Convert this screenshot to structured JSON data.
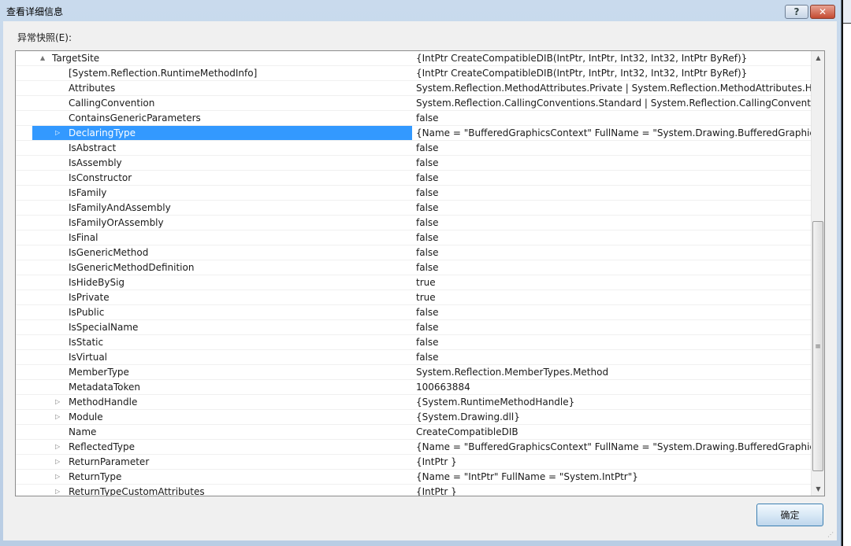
{
  "window": {
    "title": "查看详细信息",
    "help_label": "?",
    "close_label": "✕"
  },
  "snapshot_label": "异常快照(E):",
  "ok_label": "确定",
  "rows": [
    {
      "name": "TargetSite",
      "value": "{IntPtr CreateCompatibleDIB(IntPtr, IntPtr, Int32, Int32, IntPtr ByRef)}",
      "level": 0,
      "expander": "▲"
    },
    {
      "name": "[System.Reflection.RuntimeMethodInfo]",
      "value": "{IntPtr CreateCompatibleDIB(IntPtr, IntPtr, Int32, Int32, IntPtr ByRef)}",
      "level": 1,
      "expander": ""
    },
    {
      "name": "Attributes",
      "value": "System.Reflection.MethodAttributes.Private | System.Reflection.MethodAttributes.HideB",
      "level": 1,
      "expander": ""
    },
    {
      "name": "CallingConvention",
      "value": "System.Reflection.CallingConventions.Standard | System.Reflection.CallingConventions.H",
      "level": 1,
      "expander": ""
    },
    {
      "name": "ContainsGenericParameters",
      "value": "false",
      "level": 1,
      "expander": ""
    },
    {
      "name": "DeclaringType",
      "value": "{Name = \"BufferedGraphicsContext\" FullName = \"System.Drawing.BufferedGraphicsCo",
      "level": 1,
      "expander": "▷",
      "selected": true
    },
    {
      "name": "IsAbstract",
      "value": "false",
      "level": 1,
      "expander": ""
    },
    {
      "name": "IsAssembly",
      "value": "false",
      "level": 1,
      "expander": ""
    },
    {
      "name": "IsConstructor",
      "value": "false",
      "level": 1,
      "expander": ""
    },
    {
      "name": "IsFamily",
      "value": "false",
      "level": 1,
      "expander": ""
    },
    {
      "name": "IsFamilyAndAssembly",
      "value": "false",
      "level": 1,
      "expander": ""
    },
    {
      "name": "IsFamilyOrAssembly",
      "value": "false",
      "level": 1,
      "expander": ""
    },
    {
      "name": "IsFinal",
      "value": "false",
      "level": 1,
      "expander": ""
    },
    {
      "name": "IsGenericMethod",
      "value": "false",
      "level": 1,
      "expander": ""
    },
    {
      "name": "IsGenericMethodDefinition",
      "value": "false",
      "level": 1,
      "expander": ""
    },
    {
      "name": "IsHideBySig",
      "value": "true",
      "level": 1,
      "expander": ""
    },
    {
      "name": "IsPrivate",
      "value": "true",
      "level": 1,
      "expander": ""
    },
    {
      "name": "IsPublic",
      "value": "false",
      "level": 1,
      "expander": ""
    },
    {
      "name": "IsSpecialName",
      "value": "false",
      "level": 1,
      "expander": ""
    },
    {
      "name": "IsStatic",
      "value": "false",
      "level": 1,
      "expander": ""
    },
    {
      "name": "IsVirtual",
      "value": "false",
      "level": 1,
      "expander": ""
    },
    {
      "name": "MemberType",
      "value": "System.Reflection.MemberTypes.Method",
      "level": 1,
      "expander": ""
    },
    {
      "name": "MetadataToken",
      "value": "100663884",
      "level": 1,
      "expander": ""
    },
    {
      "name": "MethodHandle",
      "value": "{System.RuntimeMethodHandle}",
      "level": 1,
      "expander": "▷"
    },
    {
      "name": "Module",
      "value": "{System.Drawing.dll}",
      "level": 1,
      "expander": "▷"
    },
    {
      "name": "Name",
      "value": "CreateCompatibleDIB",
      "level": 1,
      "expander": ""
    },
    {
      "name": "ReflectedType",
      "value": "{Name = \"BufferedGraphicsContext\" FullName = \"System.Drawing.BufferedGraphicsCo",
      "level": 1,
      "expander": "▷"
    },
    {
      "name": "ReturnParameter",
      "value": "{IntPtr }",
      "level": 1,
      "expander": "▷"
    },
    {
      "name": "ReturnType",
      "value": "{Name = \"IntPtr\" FullName = \"System.IntPtr\"}",
      "level": 1,
      "expander": "▷"
    },
    {
      "name": "ReturnTypeCustomAttributes",
      "value": "{IntPtr }",
      "level": 1,
      "expander": "▷"
    }
  ],
  "scrollbar": {
    "position_fraction": 0.4,
    "visible_fraction": 0.56
  }
}
